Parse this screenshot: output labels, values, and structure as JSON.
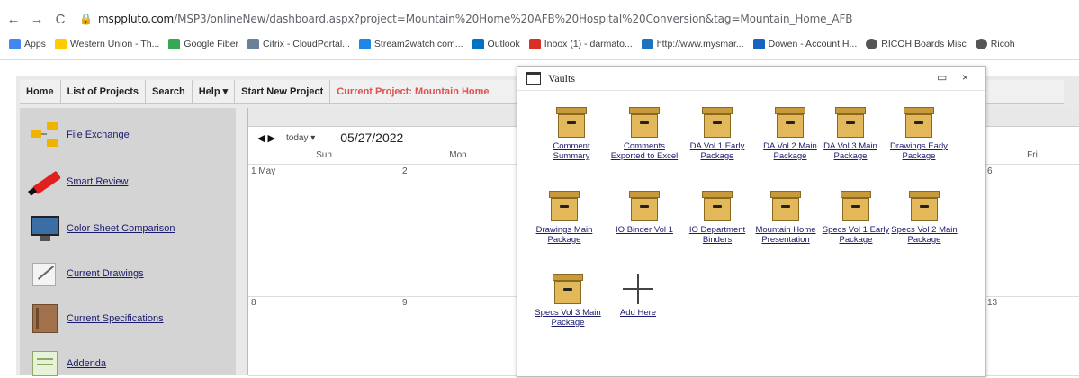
{
  "browser": {
    "url_host": "msppluto.com",
    "url_path": "/MSP3/onlineNew/dashboard.aspx?project=Mountain%20Home%20AFB%20Hospital%20Conversion&tag=Mountain_Home_AFB",
    "bookmarks": [
      {
        "label": "Apps",
        "color": "#4285f4"
      },
      {
        "label": "Western Union - Th...",
        "color": "#ffcc00"
      },
      {
        "label": "Google Fiber",
        "color": "#34a853"
      },
      {
        "label": "Citrix - CloudPortal...",
        "color": "#6a7f99"
      },
      {
        "label": "Stream2watch.com...",
        "color": "#1e88e5"
      },
      {
        "label": "Outlook",
        "color": "#0072c6"
      },
      {
        "label": "Inbox (1) - darmato...",
        "color": "#d93025"
      },
      {
        "label": "http://www.mysmar...",
        "color": "#1e73be"
      },
      {
        "label": "Dowen - Account H...",
        "color": "#1565c0"
      },
      {
        "label": "RICOH Boards Misc",
        "color": "#555555"
      },
      {
        "label": "Ricoh",
        "color": "#555555"
      }
    ]
  },
  "menu": {
    "home": "Home",
    "list_projects": "List of Projects",
    "search": "Search",
    "help": "Help ▾",
    "start_new": "Start New Project",
    "current_project": "Current Project: Mountain Home"
  },
  "sidebar": {
    "items": [
      {
        "label": "File Exchange"
      },
      {
        "label": "Smart Review"
      },
      {
        "label": "Color Sheet Comparison"
      },
      {
        "label": "Current Drawings"
      },
      {
        "label": "Current Specifications"
      },
      {
        "label": "Addenda"
      }
    ]
  },
  "calendar": {
    "today_label": "today ▾",
    "date": "05/27/2022",
    "headers": {
      "sun": "Sun",
      "mon": "Mon",
      "fri": "Fri"
    },
    "days": {
      "d1": "1 May",
      "d2": "2",
      "d6": "6",
      "d8": "8",
      "d9": "9",
      "d13": "13"
    }
  },
  "modal": {
    "title": "Vaults",
    "minimize": "▭",
    "close": "×",
    "vaults": [
      {
        "label": "Comment Summary"
      },
      {
        "label": "Comments Exported to Excel"
      },
      {
        "label": "DA Vol 1 Early Package"
      },
      {
        "label": "DA Vol 2 Main Package"
      },
      {
        "label": "DA Vol 3 Main Package"
      },
      {
        "label": "Drawings Early Package"
      },
      {
        "label": "Drawings Main Package"
      },
      {
        "label": "IO Binder Vol 1"
      },
      {
        "label": "IO Department Binders"
      },
      {
        "label": "Mountain Home Presentation"
      },
      {
        "label": "Specs Vol 1 Early Package"
      },
      {
        "label": "Specs Vol 2 Main Package"
      },
      {
        "label": "Specs Vol 3 Main Package"
      }
    ],
    "add_label": "Add Here"
  }
}
